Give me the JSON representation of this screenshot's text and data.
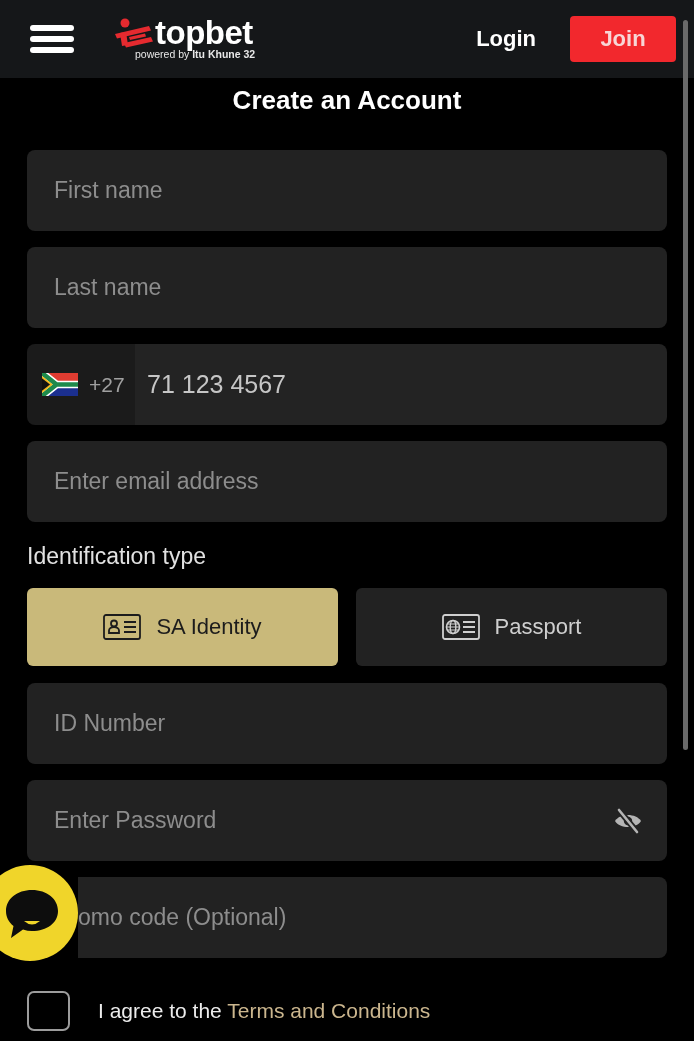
{
  "header": {
    "logo": {
      "name": "topbet",
      "tagline": "powered by **Itu Khune 32**"
    },
    "login": "Login",
    "join": "Join"
  },
  "title": "Create an Account",
  "fields": [
    {
      "kind": "text",
      "placeholder": "First name"
    },
    {
      "kind": "text",
      "placeholder": "Last name"
    },
    {
      "kind": "phone",
      "country_code": "+27",
      "placeholder": "71 123 4567"
    },
    {
      "kind": "text",
      "placeholder": "Enter email address"
    }
  ],
  "identification": {
    "label": "Identification type",
    "options": [
      {
        "kind": "id-card",
        "label": "SA Identity",
        "selected": true
      },
      {
        "kind": "passport",
        "label": "Passport",
        "selected": false
      }
    ]
  },
  "more_fields": [
    {
      "kind": "text",
      "placeholder": "ID Number"
    },
    {
      "kind": "password",
      "placeholder": "Enter Password",
      "revealed": false
    },
    {
      "kind": "promo",
      "placeholder": "omo code (Optional)"
    }
  ],
  "agree": {
    "checked": false,
    "text": "I agree to the",
    "link": "Terms and Conditions"
  }
}
